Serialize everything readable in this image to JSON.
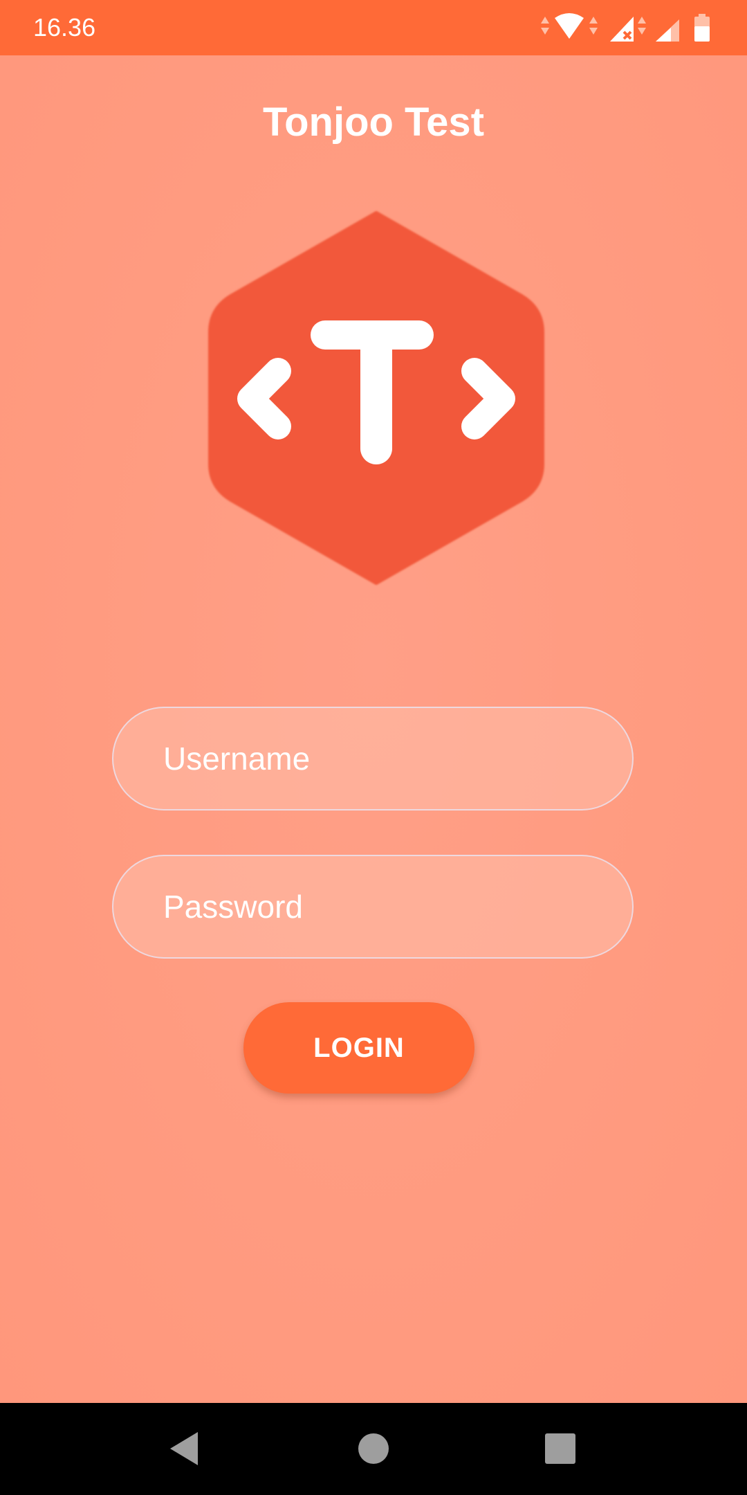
{
  "status_bar": {
    "time": "16.36",
    "icons": [
      "data-arrows-icon",
      "wifi-icon",
      "signal-no-sim-icon",
      "signal-icon",
      "battery-icon"
    ]
  },
  "app": {
    "title": "Tonjoo Test",
    "logo_icon": "tonjoo-hexagon-logo-icon"
  },
  "form": {
    "username_placeholder": "Username",
    "username_value": "",
    "password_placeholder": "Password",
    "password_value": "",
    "login_label": "LOGIN"
  },
  "nav_bar": {
    "icons": [
      "back-triangle-icon",
      "home-circle-icon",
      "recents-square-icon"
    ]
  },
  "colors": {
    "accent": "#ff6a37",
    "background": "#ff9a80",
    "logo": "#f2583a",
    "text": "#ffffff"
  }
}
